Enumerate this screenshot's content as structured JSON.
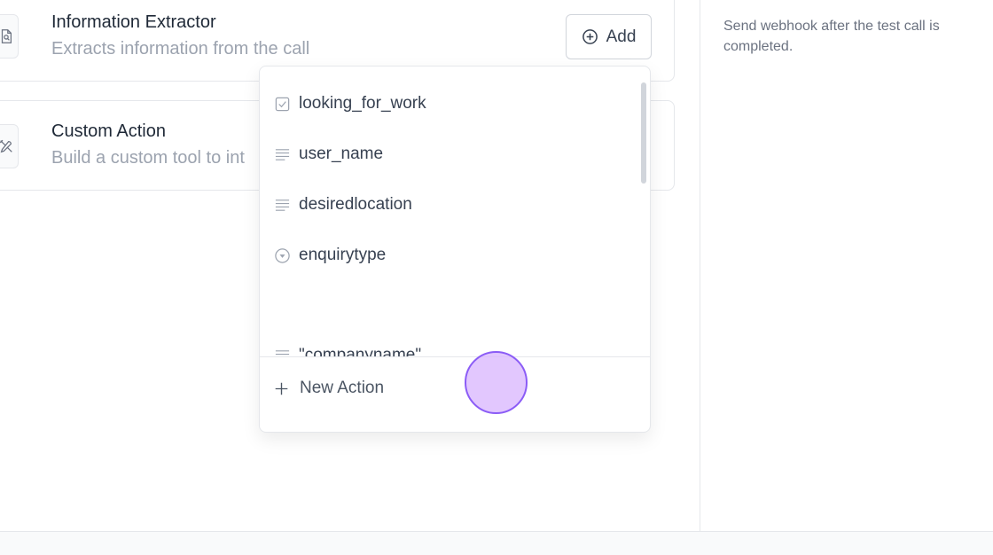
{
  "cards": {
    "info_extractor": {
      "title": "Information Extractor",
      "description": "Extracts information from the call",
      "add_label": "Add",
      "icon": "document-search-icon"
    },
    "custom_action": {
      "title": "Custom Action",
      "description": "Build a custom tool to int",
      "icon": "tools-icon"
    }
  },
  "dropdown": {
    "items": [
      {
        "label": "looking_for_work",
        "icon": "checkbox-icon"
      },
      {
        "label": "user_name",
        "icon": "text-lines-icon"
      },
      {
        "label": "desiredlocation",
        "icon": "text-lines-icon"
      },
      {
        "label": "enquirytype",
        "icon": "select-icon"
      },
      {
        "label": "\"companyname\"",
        "icon": "text-lines-icon"
      }
    ],
    "new_action_label": "New Action"
  },
  "right_panel": {
    "text": "Send webhook after the test call is completed."
  },
  "colors": {
    "accent_cursor": "#8b5cf6",
    "border": "#e5e7eb",
    "muted_text": "#9ca3af"
  }
}
